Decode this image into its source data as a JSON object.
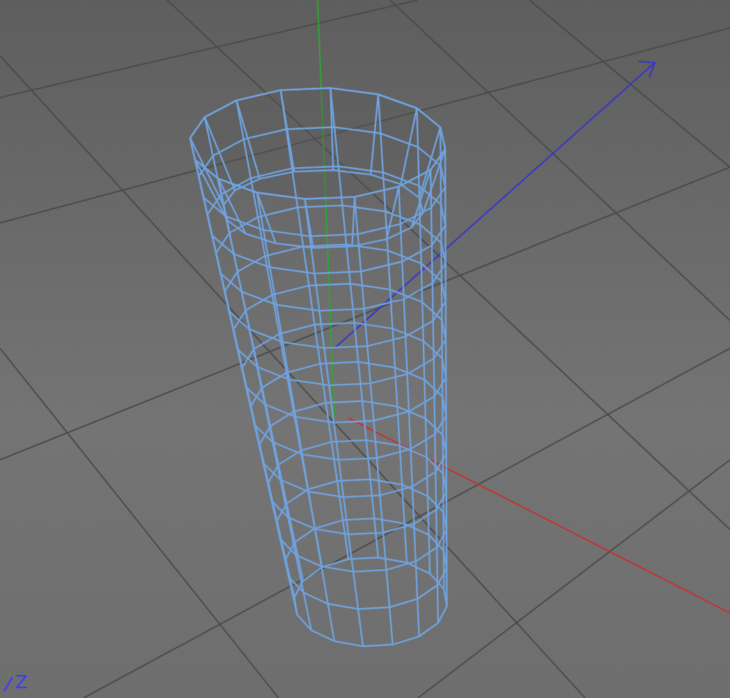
{
  "viewport": {
    "axis_gizmo": {
      "label": "Z"
    }
  }
}
